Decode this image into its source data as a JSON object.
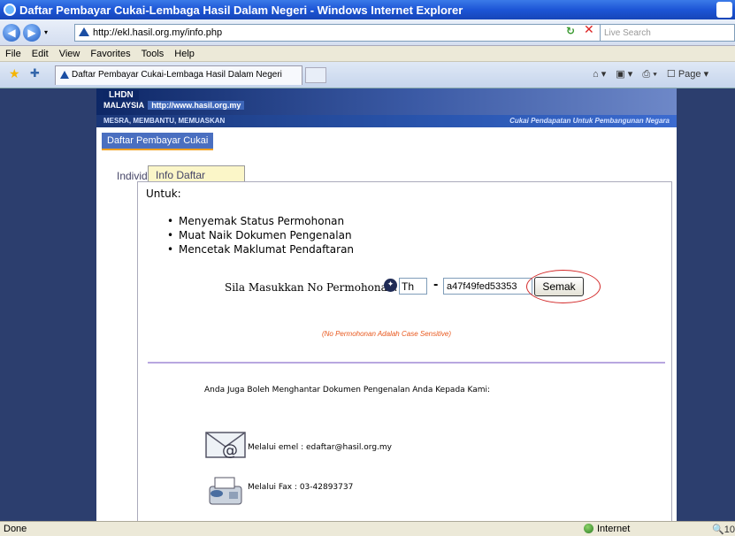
{
  "window": {
    "title": "Daftar Pembayar Cukai-Lembaga Hasil Dalam Negeri - Windows Internet Explorer"
  },
  "address": {
    "url": "http://ekl.hasil.org.my/info.php",
    "search_placeholder": "Live Search"
  },
  "menu": [
    "File",
    "Edit",
    "View",
    "Favorites",
    "Tools",
    "Help"
  ],
  "tab": {
    "title": "Daftar Pembayar Cukai-Lembaga Hasil Dalam Negeri"
  },
  "toolbar": {
    "page": "Page"
  },
  "banner": {
    "lhdn": "LHDN",
    "malaysia": "MALAYSIA",
    "url": "http://www.hasil.org.my",
    "motto_left": "MESRA, MEMBANTU, MEMUASKAN",
    "motto_right": "Cukai Pendapatan Untuk Pembangunan Negara"
  },
  "nav": {
    "daftar": "Daftar Pembayar Cukai"
  },
  "tabs": {
    "individu": "Individu",
    "info_daftar": "Info Daftar"
  },
  "untuk": "Untuk:",
  "bullets": [
    "Menyemak Status Permohonan",
    "Muat Naik Dokumen Pengenalan",
    "Mencetak Maklumat Pendaftaran"
  ],
  "form": {
    "label": "Sila Masukkan No Permohonan:",
    "prefix_value": "Th",
    "number_value": "a47f49fed53353",
    "button": "Semak",
    "note": "(No Permohonan Adalah Case Sensitive)"
  },
  "contact": {
    "intro": "Anda Juga Boleh Menghantar Dokumen Pengenalan Anda Kepada Kami:",
    "email": "Melalui emel : edaftar@hasil.org.my",
    "fax": "Melalui Fax : 03-42893737"
  },
  "status": {
    "left": "Done",
    "zone": "Internet",
    "zoom": "10"
  },
  "colors": {
    "accent": "#e8571c",
    "highlight_circle": "#d32a2a",
    "divider": "#b8a7e0"
  }
}
